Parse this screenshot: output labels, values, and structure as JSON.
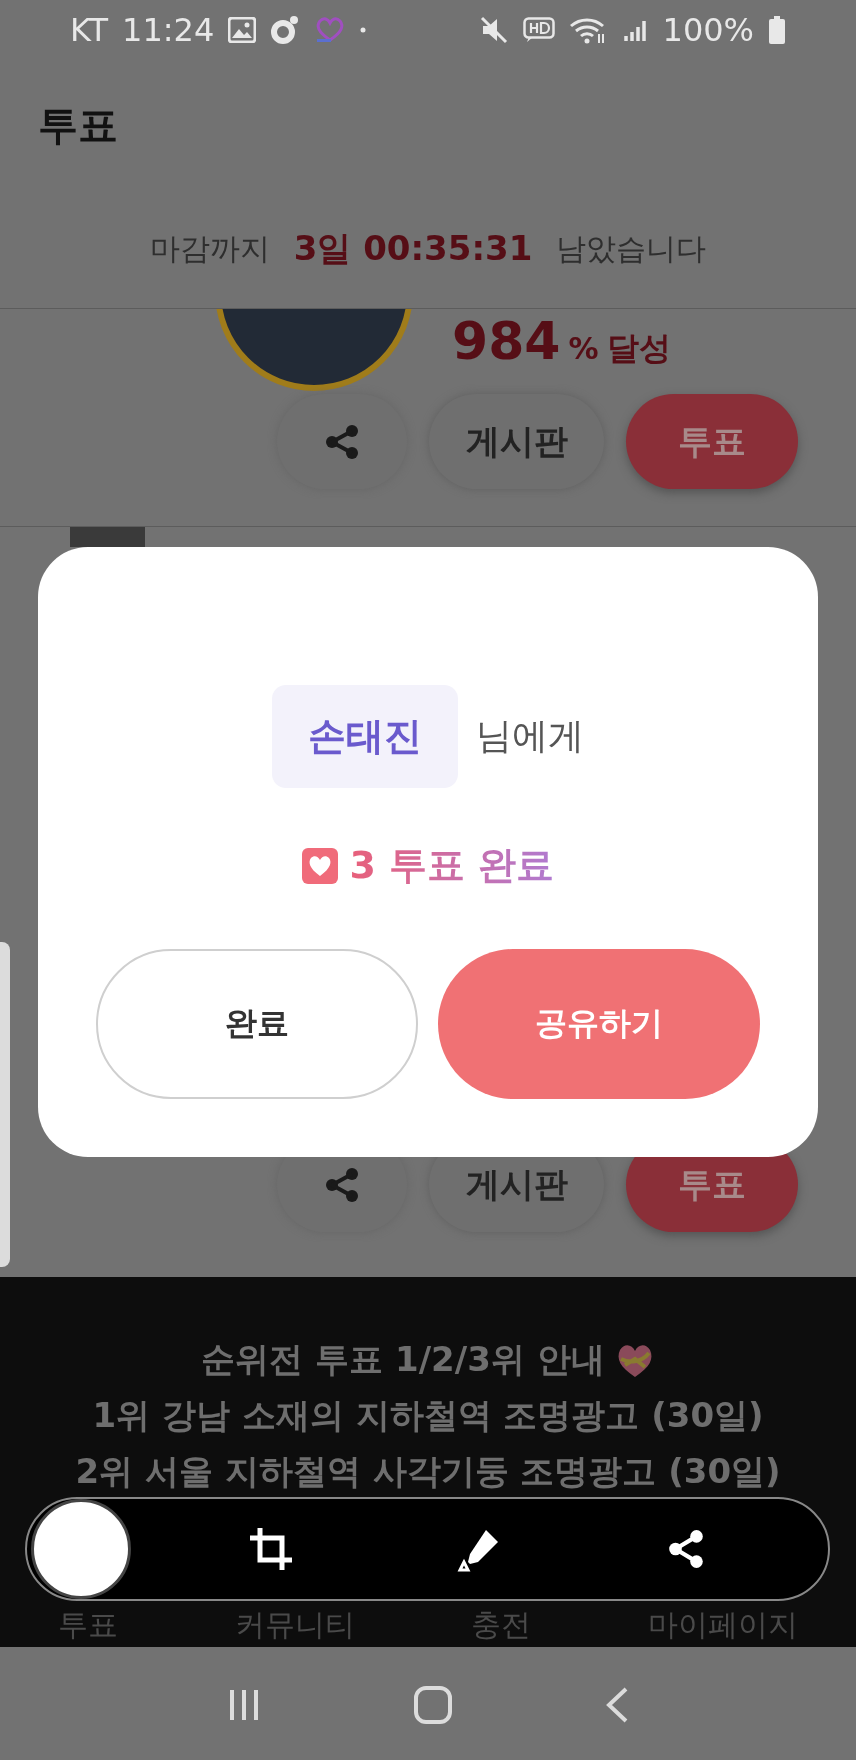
{
  "status_bar": {
    "carrier": "KT",
    "time": "11:24",
    "battery": "100%"
  },
  "header": {
    "title": "투표"
  },
  "countdown": {
    "prefix": "마감까지",
    "remaining": "3일 00:35:31",
    "suffix": "남았습니다"
  },
  "cards": [
    {
      "achievement": "984",
      "unit": "%",
      "achievement_label": "달성",
      "board_label": "게시판",
      "vote_label": "투표"
    },
    {
      "board_label": "게시판",
      "vote_label": "투표"
    }
  ],
  "dialog": {
    "recipient": "손태진",
    "recipient_suffix": "님에게",
    "count": "3",
    "result_label": "투표 완료",
    "buttons": [
      {
        "label": "완료",
        "kind": "secondary"
      },
      {
        "label": "공유하기",
        "kind": "primary"
      }
    ]
  },
  "banner": {
    "lines": [
      "순위전 투표 1/2/3위 안내",
      "1위 강남 소재의 지하철역 조명광고 (30일)",
      "2위 서울 지하철역 사각기둥 조명광고 (30일)"
    ]
  },
  "bottom_nav": [
    {
      "label": "투표"
    },
    {
      "label": "커뮤니티"
    },
    {
      "label": "충전"
    },
    {
      "label": "마이페이지"
    }
  ]
}
